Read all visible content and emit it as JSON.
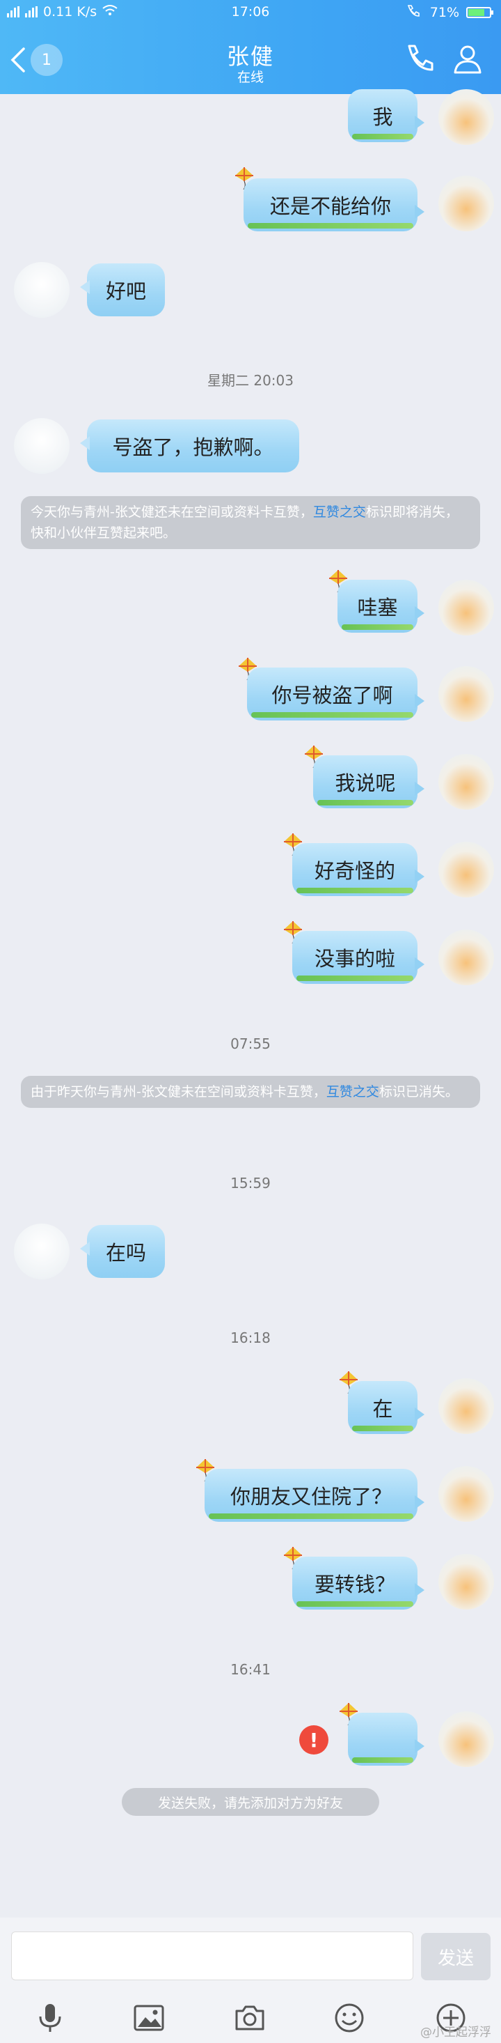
{
  "status_bar": {
    "network": "0.11 K/s",
    "time": "17:06",
    "battery": "71%",
    "battery_level": 0.71
  },
  "header": {
    "back_badge": "1",
    "title": "张健",
    "subtitle": "在线"
  },
  "messages": {
    "m0": "我",
    "m1": "还是不能给你",
    "m2": "好吧",
    "t1": "星期二 20:03",
    "m3": "号盗了，抱歉啊。",
    "notice1_text": "今天你与青州-张文健还未在空间或资料卡互赞，",
    "notice1_link": "互赞之交",
    "notice1_rest": "标识即将消失，快和小伙伴互赞起来吧。",
    "m4": "哇塞",
    "m5": "你号被盗了啊",
    "m6": "我说呢",
    "m7": "好奇怪的",
    "m8": "没事的啦",
    "t2": "07:55",
    "notice2_text": "由于昨天你与青州-张文健未在空间或资料卡互赞，",
    "notice2_link": "互赞之交",
    "notice2_rest": "标识已消失。",
    "t3": "15:59",
    "m9": "在吗",
    "t4": "16:18",
    "m10": "在",
    "m11": "你朋友又住院了？",
    "m12": "要转钱？",
    "t5": "16:41",
    "error_mark": "!",
    "fail_text": "发送失败，请先添加对方为好友"
  },
  "input": {
    "placeholder": "",
    "send_label": "发送"
  },
  "watermark": "@小王起浮浮",
  "colors": {
    "header": "#3fa6f4",
    "bubble": "#9ed6f6",
    "error": "#ef4a3c",
    "link": "#2f88e0"
  }
}
